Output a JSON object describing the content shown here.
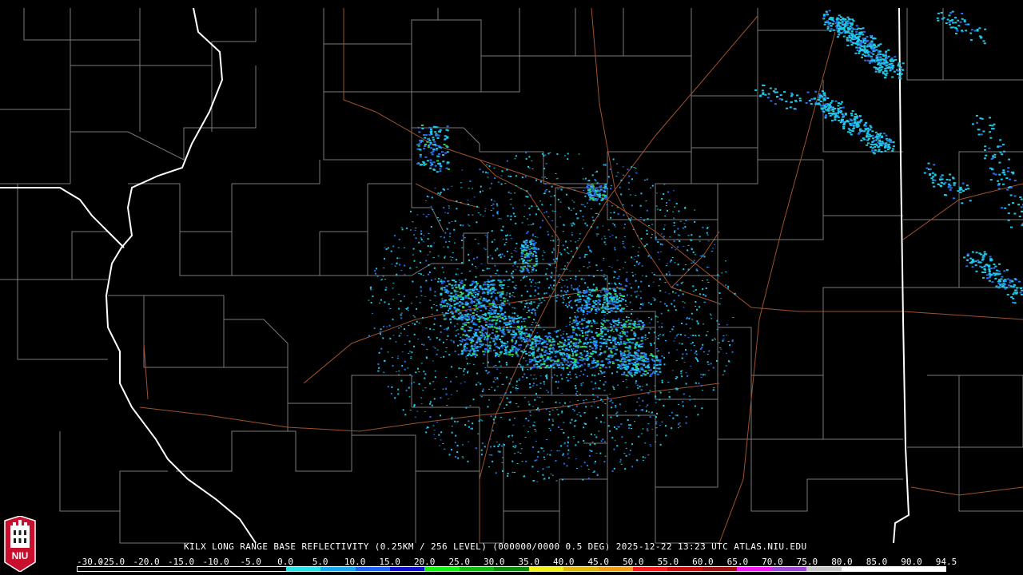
{
  "caption": "KILX LONG RANGE BASE REFLECTIVITY (0.25KM / 256 LEVEL) (000000/0000 0.5 DEG) 2025-12-22 13:23 UTC  ATLAS.NIU.EDU",
  "logo_text": "NIU",
  "scale": {
    "labels": [
      "-30.0",
      "-25.0",
      "-20.0",
      "-15.0",
      "-10.0",
      "-5.0",
      "0.0",
      "5.0",
      "10.0",
      "15.0",
      "20.0",
      "25.0",
      "30.0",
      "35.0",
      "40.0",
      "45.0",
      "50.0",
      "55.0",
      "60.0",
      "65.0",
      "70.0",
      "75.0",
      "80.0",
      "85.0",
      "90.0",
      "94.5"
    ],
    "colors": [
      "#000000",
      "#000000",
      "#000000",
      "#000000",
      "#000000",
      "#000000",
      "#29e3e6",
      "#1aa5f0",
      "#1f5ff2",
      "#0f12c9",
      "#14f214",
      "#0fba0f",
      "#0a8a0a",
      "#f2f21a",
      "#e0b80f",
      "#f29a1a",
      "#f21a1a",
      "#c40f0f",
      "#a00f0f",
      "#f21af2",
      "#9a4ad6",
      "#c8c8c8",
      "#ffffff",
      "#ffffff",
      "#ffffff"
    ]
  },
  "colors": {
    "county_lines": "#7a7a7a",
    "state_lines": "#ffffff",
    "highways": "#a0522d",
    "radar_light": "#22c8e8",
    "radar_mid": "#2a6ee8",
    "radar_strong": "#3ad23a"
  }
}
